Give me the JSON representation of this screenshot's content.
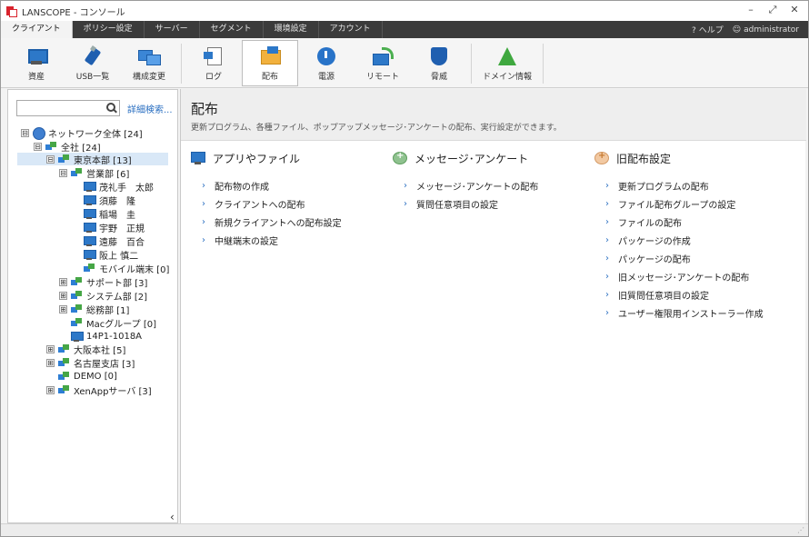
{
  "window": {
    "title": "LANSCOPE - コンソール",
    "controls": [
      "–",
      "⤢",
      "✕"
    ]
  },
  "menubar": {
    "tabs": [
      {
        "label": "クライアント",
        "active": true
      },
      {
        "label": "ポリシー設定",
        "active": false
      },
      {
        "label": "サーバー",
        "active": false
      },
      {
        "label": "セグメント",
        "active": false
      },
      {
        "label": "環境設定",
        "active": false
      },
      {
        "label": "アカウント",
        "active": false
      }
    ],
    "help": "ヘルプ",
    "user": "administrator"
  },
  "toolbar": {
    "items": [
      {
        "label": "資産",
        "icon": "asset-icon",
        "active": false
      },
      {
        "label": "USB一覧",
        "icon": "usb-icon",
        "active": false
      },
      {
        "label": "構成変更",
        "icon": "config-change-icon",
        "active": false
      },
      {
        "label": "ログ",
        "icon": "log-icon",
        "active": false
      },
      {
        "label": "配布",
        "icon": "distribution-icon",
        "active": true
      },
      {
        "label": "電源",
        "icon": "power-icon",
        "active": false
      },
      {
        "label": "リモート",
        "icon": "remote-icon",
        "active": false
      },
      {
        "label": "脅威",
        "icon": "threat-shield-icon",
        "active": false
      },
      {
        "label": "ドメイン情報",
        "icon": "domain-info-icon",
        "active": false
      }
    ]
  },
  "sidebar": {
    "search_value": "",
    "advanced_search": "詳細検索...",
    "tree": [
      {
        "label": "ネットワーク全体 [24]",
        "toggle": "⊟",
        "icon": "globe"
      },
      {
        "label": "全社 [24]",
        "toggle": "⊟",
        "icon": "group"
      },
      {
        "label": "東京本部 [13]",
        "toggle": "⊟",
        "icon": "group",
        "selected": true
      },
      {
        "label": "営業部 [6]",
        "toggle": "⊟",
        "icon": "group"
      },
      {
        "label": "茂礼手　太郎",
        "toggle": "",
        "icon": "pc"
      },
      {
        "label": "須藤　隆",
        "toggle": "",
        "icon": "pc"
      },
      {
        "label": "稲場　圭",
        "toggle": "",
        "icon": "pc"
      },
      {
        "label": "宇野　正規",
        "toggle": "",
        "icon": "pc"
      },
      {
        "label": "遠藤　百合",
        "toggle": "",
        "icon": "pc"
      },
      {
        "label": "阪上 慎二",
        "toggle": "",
        "icon": "pc"
      },
      {
        "label": "モバイル端末 [0]",
        "toggle": "",
        "icon": "group"
      },
      {
        "label": "サポート部 [3]",
        "toggle": "⊞",
        "icon": "group"
      },
      {
        "label": "システム部 [2]",
        "toggle": "⊞",
        "icon": "group"
      },
      {
        "label": "総務部 [1]",
        "toggle": "⊞",
        "icon": "group"
      },
      {
        "label": "Macグループ [0]",
        "toggle": "",
        "icon": "group"
      },
      {
        "label": "14P1-1018A",
        "toggle": "",
        "icon": "pc"
      },
      {
        "label": "大阪本社 [5]",
        "toggle": "⊞",
        "icon": "group"
      },
      {
        "label": "名古屋支店 [3]",
        "toggle": "⊞",
        "icon": "group"
      },
      {
        "label": "DEMO [0]",
        "toggle": "",
        "icon": "group"
      },
      {
        "label": "XenAppサーバ [3]",
        "toggle": "⊞",
        "icon": "group"
      }
    ],
    "collapse": "‹"
  },
  "main": {
    "title": "配布",
    "description": "更新プログラム、各種ファイル、ポップアップメッセージ･アンケートの配布、実行設定ができます。",
    "sections": [
      {
        "title": "アプリやファイル",
        "icon": "app-file-icon",
        "links": [
          "配布物の作成",
          "クライアントへの配布",
          "新規クライアントへの配布設定",
          "中継端末の設定"
        ]
      },
      {
        "title": "メッセージ･アンケート",
        "icon": "message-survey-icon",
        "links": [
          "メッセージ･アンケートの配布",
          "質問任意項目の設定"
        ]
      },
      {
        "title": "旧配布設定",
        "icon": "legacy-distribution-icon",
        "links": [
          "更新プログラムの配布",
          "ファイル配布グループの設定",
          "ファイルの配布",
          "パッケージの作成",
          "パッケージの配布",
          "旧メッセージ･アンケートの配布",
          "旧質問任意項目の設定",
          "ユーザー権限用インストーラー作成"
        ]
      }
    ]
  }
}
